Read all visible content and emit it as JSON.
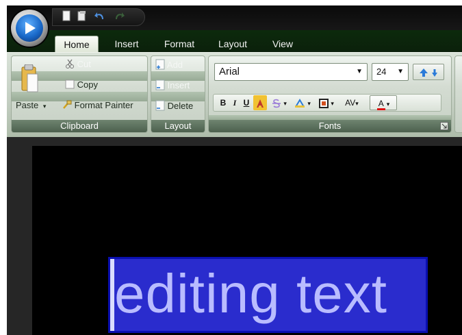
{
  "tabs": [
    "Home",
    "Insert",
    "Format",
    "Layout",
    "View"
  ],
  "clipboard": {
    "cut": "Cut",
    "copy": "Copy",
    "paste": "Paste",
    "format_painter": "Format Painter",
    "label": "Clipboard"
  },
  "layout_group": {
    "add": "Add",
    "insert": "Insert",
    "delete": "Delete",
    "label": "Layout"
  },
  "fonts": {
    "font_name": "Arial",
    "font_size": "24",
    "bold": "B",
    "italic": "I",
    "underline": "U",
    "char_spacing": "AV",
    "font_color": "A",
    "label": "Fonts"
  },
  "document": {
    "selected_text": "editing text"
  },
  "colors": {
    "tab_bar": "#0b200b",
    "ribbon": "#c2cdc0",
    "group_label": "#4c604d",
    "selection": "#2a2ccd",
    "selected_text": "#b9bcff"
  },
  "icons": [
    "app-orb-icon",
    "new-document-icon",
    "open-document-icon",
    "undo-icon",
    "redo-icon",
    "cut-icon",
    "copy-icon",
    "paste-icon",
    "format-painter-icon",
    "add-slide-icon",
    "insert-slide-icon",
    "delete-slide-icon",
    "grow-font-icon",
    "shrink-font-icon",
    "dialog-launcher-icon"
  ]
}
